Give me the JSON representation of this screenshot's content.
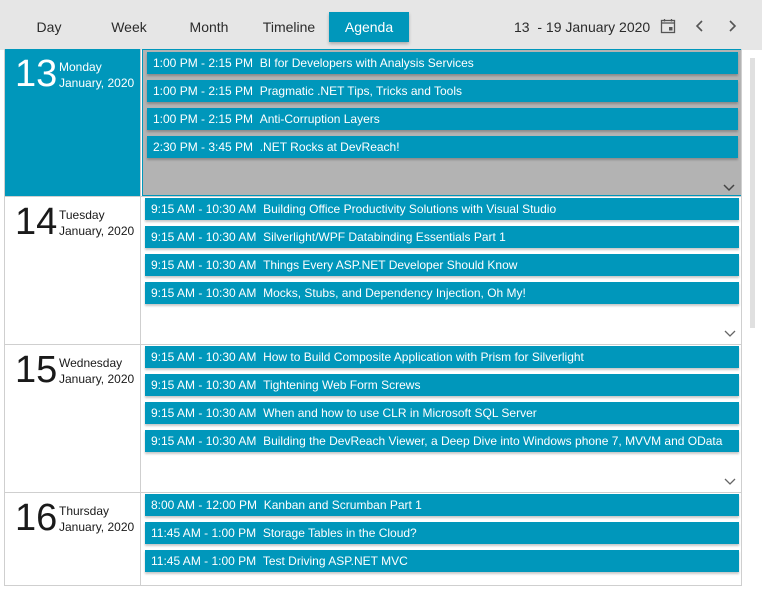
{
  "toolbar": {
    "views": [
      {
        "label": "Day",
        "active": false
      },
      {
        "label": "Week",
        "active": false
      },
      {
        "label": "Month",
        "active": false
      },
      {
        "label": "Timeline",
        "active": false
      },
      {
        "label": "Agenda",
        "active": true
      }
    ],
    "range_label": "13  - 19 January 2020",
    "icons": [
      "calendar-icon",
      "chevron-left-icon",
      "chevron-right-icon"
    ]
  },
  "colors": {
    "accent": "#0097bb",
    "toolbar_bg": "#e6e6e6",
    "overflow_bg": "#b3b3b3"
  },
  "days": [
    {
      "number": "13",
      "weekday": "Monday",
      "month_year": "January, 2020",
      "selected": true,
      "events": [
        {
          "time": "1:00 PM - 2:15 PM",
          "title": "BI for Developers with Analysis Services"
        },
        {
          "time": "1:00 PM - 2:15 PM",
          "title": "Pragmatic .NET Tips, Tricks and Tools"
        },
        {
          "time": "1:00 PM - 2:15 PM",
          "title": "Anti-Corruption Layers"
        },
        {
          "time": "2:30 PM - 3:45 PM",
          "title": ".NET Rocks at DevReach!"
        }
      ]
    },
    {
      "number": "14",
      "weekday": "Tuesday",
      "month_year": "January, 2020",
      "selected": false,
      "events": [
        {
          "time": "9:15 AM - 10:30 AM",
          "title": "Building Office Productivity Solutions with Visual Studio"
        },
        {
          "time": "9:15 AM - 10:30 AM",
          "title": "Silverlight/WPF Databinding Essentials Part 1"
        },
        {
          "time": "9:15 AM - 10:30 AM",
          "title": "Things Every ASP.NET Developer Should Know"
        },
        {
          "time": "9:15 AM - 10:30 AM",
          "title": "Mocks, Stubs, and Dependency Injection, Oh My!"
        }
      ]
    },
    {
      "number": "15",
      "weekday": "Wednesday",
      "month_year": "January, 2020",
      "selected": false,
      "events": [
        {
          "time": "9:15 AM - 10:30 AM",
          "title": "How to Build Composite Application with Prism for Silverlight"
        },
        {
          "time": "9:15 AM - 10:30 AM",
          "title": "Tightening Web Form Screws"
        },
        {
          "time": "9:15 AM - 10:30 AM",
          "title": "When and how to use CLR in Microsoft SQL Server"
        },
        {
          "time": "9:15 AM - 10:30 AM",
          "title": "Building the DevReach Viewer, a Deep Dive into Windows phone 7, MVVM and OData"
        }
      ]
    },
    {
      "number": "16",
      "weekday": "Thursday",
      "month_year": "January, 2020",
      "selected": false,
      "events": [
        {
          "time": "8:00 AM - 12:00 PM",
          "title": "Kanban and Scrumban Part 1"
        },
        {
          "time": "11:45 AM - 1:00 PM",
          "title": "Storage Tables in the Cloud?"
        },
        {
          "time": "11:45 AM - 1:00 PM",
          "title": "Test Driving ASP.NET MVC"
        }
      ]
    }
  ]
}
